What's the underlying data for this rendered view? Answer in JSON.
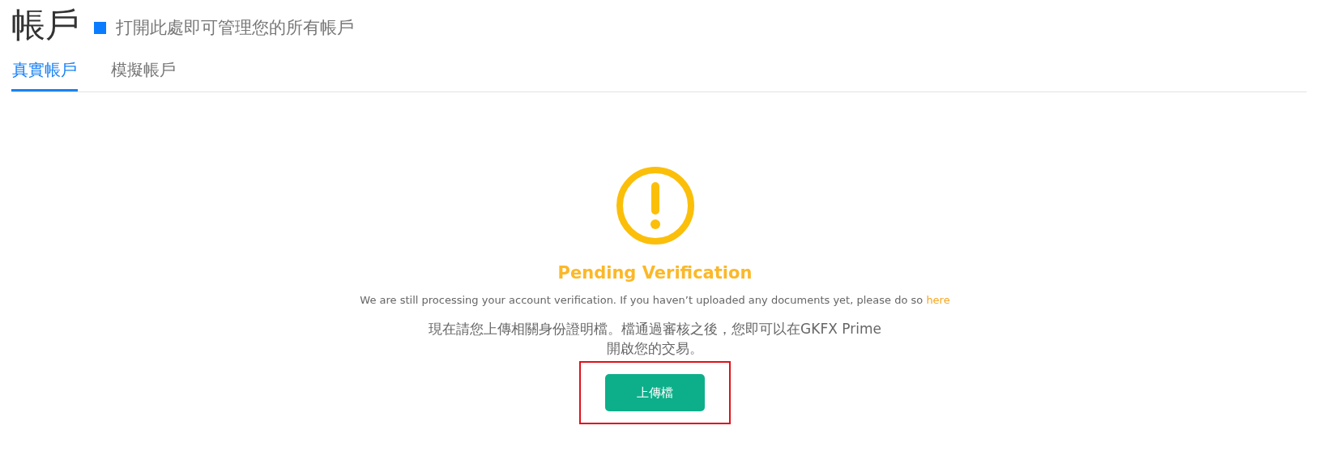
{
  "header": {
    "title": "帳戶",
    "subtitle": "打開此處即可管理您的所有帳戶"
  },
  "tabs": [
    {
      "label": "真實帳戶",
      "selected": true
    },
    {
      "label": "模擬帳戶",
      "selected": false
    }
  ],
  "status": {
    "kind": "warning",
    "heading": "Pending Verification",
    "message": "We are still processing your account verification. If you haven’t uploaded any documents yet, please do so",
    "link": "here",
    "instructions": [
      "現在請您上傳相關身份證明檔。檔通過審核之後，您即可以在GKFX Prime",
      "開啟您的交易。"
    ]
  },
  "upload_button": {
    "label": "上傳檔",
    "highlighted": true
  }
}
